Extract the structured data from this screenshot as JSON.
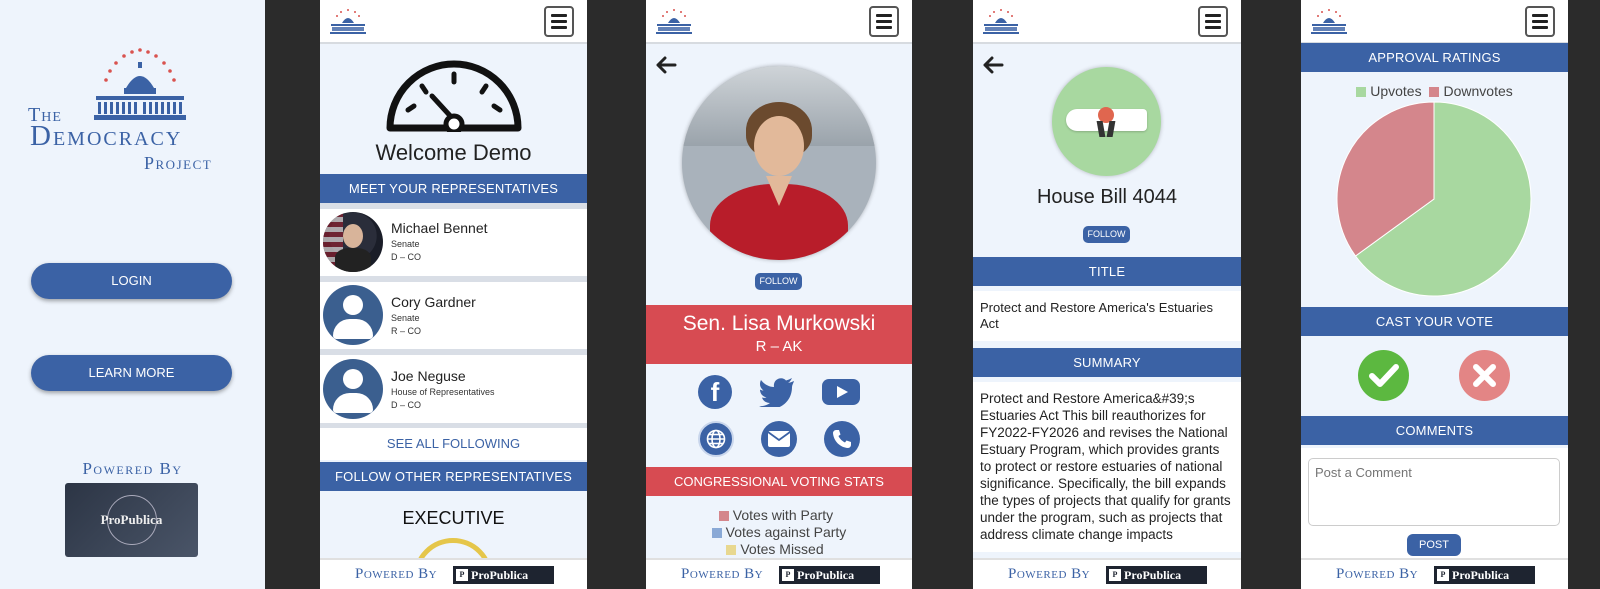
{
  "landing": {
    "logo_the": "The",
    "logo_democracy": "Democracy",
    "logo_project": "Project",
    "login_label": "LOGIN",
    "learn_more_label": "LEARN MORE",
    "powered_by": "Powered By",
    "propublica_badge": "ProPublica"
  },
  "footer": {
    "powered_by": "Powered By",
    "propublica": "ProPublica"
  },
  "dashboard": {
    "welcome": "Welcome Demo",
    "meet_header": "MEET YOUR REPRESENTATIVES",
    "reps": [
      {
        "name": "Michael Bennet",
        "chamber": "Senate",
        "party": "D – CO",
        "photo": true
      },
      {
        "name": "Cory Gardner",
        "chamber": "Senate",
        "party": "R – CO",
        "photo": false
      },
      {
        "name": "Joe Neguse",
        "chamber": "House of Representatives",
        "party": "D – CO",
        "photo": false
      }
    ],
    "see_all": "SEE ALL FOLLOWING",
    "follow_other": "FOLLOW OTHER REPRESENTATIVES",
    "executive": "EXECUTIVE"
  },
  "profile": {
    "follow": "FOLLOW",
    "name": "Sen. Lisa Murkowski",
    "party_state": "R – AK",
    "social_icons": [
      "facebook-icon",
      "twitter-icon",
      "youtube-icon",
      "globe-icon",
      "mail-icon",
      "phone-icon"
    ],
    "stats_header": "CONGRESSIONAL VOTING STATS",
    "legend": [
      "Votes with Party",
      "Votes against Party",
      "Votes Missed"
    ]
  },
  "bill": {
    "title_heading": "House Bill 4044",
    "follow": "FOLLOW",
    "title_bar": "TITLE",
    "title_text": "Protect and Restore America's Estuaries Act",
    "summary_bar": "SUMMARY",
    "summary_text": "Protect and Restore America&#39;s Estuaries Act This bill reauthorizes for FY2022-FY2026 and revises the National Estuary Program, which provides grants to protect or restore estuaries of national significance. Specifically, the bill expands the types of projects that qualify for grants under the program, such as projects that address climate change impacts"
  },
  "ratings": {
    "approval_bar": "APPROVAL RATINGS",
    "cast_vote_bar": "CAST YOUR VOTE",
    "comments_bar": "COMMENTS",
    "comment_placeholder": "Post a Comment",
    "post_button": "POST"
  },
  "chart_data": {
    "type": "pie",
    "categories": [
      "Upvotes",
      "Downvotes"
    ],
    "values": [
      65,
      35
    ],
    "colors": [
      "#a8d8a0",
      "#d4868c"
    ],
    "legend_position": "top"
  },
  "colors": {
    "primary": "#3b62a5",
    "red_banner": "#d74b52",
    "upvote": "#a8d8a0",
    "downvote": "#d4868c",
    "approve": "#5cb840",
    "reject": "#e38585"
  }
}
